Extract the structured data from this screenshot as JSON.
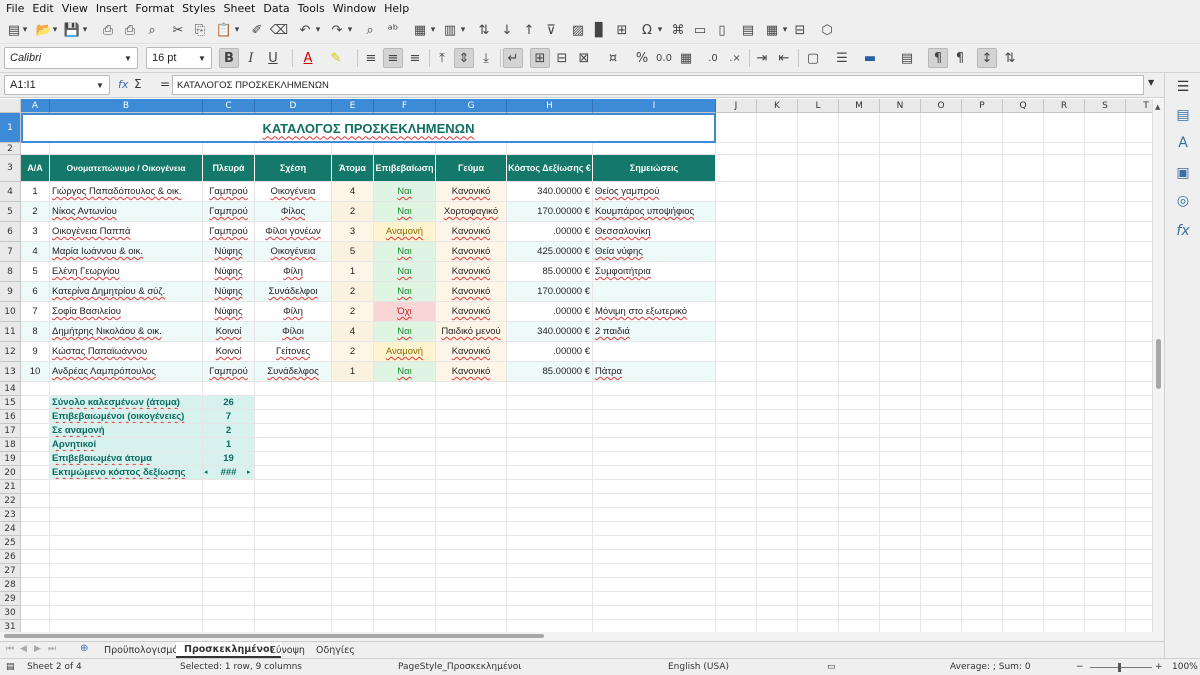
{
  "menu": [
    "File",
    "Edit",
    "View",
    "Insert",
    "Format",
    "Styles",
    "Sheet",
    "Data",
    "Tools",
    "Window",
    "Help"
  ],
  "toolbar": {
    "font_name": "Calibri",
    "font_size": "16 pt",
    "bold": "B",
    "italic": "I",
    "underline": "U",
    "percent": "%",
    "decimals": "0.0"
  },
  "formula_bar": {
    "name_box": "A1:I1",
    "fx": "fx",
    "sigma": "Σ",
    "equals": "=",
    "content": "ΚΑΤΑΛΟΓΟΣ ΠΡΟΣΚΕΚΛΗΜΕΝΩΝ"
  },
  "columns": [
    "A",
    "B",
    "C",
    "D",
    "E",
    "F",
    "G",
    "H",
    "I",
    "J",
    "K",
    "L",
    "M",
    "N",
    "O",
    "P",
    "Q",
    "R",
    "S",
    "T"
  ],
  "rows": [
    "1",
    "2",
    "3",
    "4",
    "5",
    "6",
    "7",
    "8",
    "9",
    "10",
    "11",
    "12",
    "13",
    "14",
    "15",
    "16",
    "17",
    "18",
    "19",
    "20",
    "21",
    "22",
    "23",
    "24",
    "25",
    "26",
    "27",
    "28",
    "29",
    "30",
    "31"
  ],
  "sheet": {
    "title": "ΚΑΤΑΛΟΓΟΣ ΠΡΟΣΚΕΚΛΗΜΕΝΩΝ",
    "headers": [
      "Α/Α",
      "Ονοματεπώνυμο / Οικογένεια",
      "Πλευρά",
      "Σχέση",
      "Άτομα",
      "Επιβεβαίωση",
      "Γεύμα",
      "Κόστος Δεξίωσης €",
      "Σημειώσεις"
    ],
    "guests": [
      [
        "1",
        "Γιώργος Παπαδόπουλος & οικ.",
        "Γαμπρού",
        "Οικογένεια",
        "4",
        "Ναι",
        "Κανονικό",
        "340.00000 €",
        "Θείος γαμπρού"
      ],
      [
        "2",
        "Νίκος Αντωνίου",
        "Γαμπρού",
        "Φίλος",
        "2",
        "Ναι",
        "Χορτοφαγικό",
        "170.00000 €",
        "Κουμπάρος υποψήφιος"
      ],
      [
        "3",
        "Οικογένεια Παππά",
        "Γαμπρού",
        "Φίλοι γονέων",
        "3",
        "Αναμονή",
        "Κανονικό",
        ".00000 €",
        "Θεσσαλονίκη"
      ],
      [
        "4",
        "Μαρία Ιωάννου & οικ.",
        "Νύφης",
        "Οικογένεια",
        "5",
        "Ναι",
        "Κανονικό",
        "425.00000 €",
        "Θεία νύφης"
      ],
      [
        "5",
        "Ελένη Γεωργίου",
        "Νύφης",
        "Φίλη",
        "1",
        "Ναι",
        "Κανονικό",
        "85.00000 €",
        "Συμφοιτήτρια"
      ],
      [
        "6",
        "Κατερίνα Δημητρίου & σύζ.",
        "Νύφης",
        "Συνάδελφοι",
        "2",
        "Ναι",
        "Κανονικό",
        "170.00000 €",
        ""
      ],
      [
        "7",
        "Σοφία Βασιλείου",
        "Νύφης",
        "Φίλη",
        "2",
        "Όχι",
        "Κανονικό",
        ".00000 €",
        "Μόνιμη στο εξωτερικό"
      ],
      [
        "8",
        "Δημήτρης Νικολάου & οικ.",
        "Κοινοί",
        "Φίλοι",
        "4",
        "Ναι",
        "Παιδικό μενού",
        "340.00000 €",
        "2 παιδιά"
      ],
      [
        "9",
        "Κώστας Παπαϊωάννου",
        "Κοινοί",
        "Γείτονες",
        "2",
        "Αναμονή",
        "Κανονικό",
        ".00000 €",
        ""
      ],
      [
        "10",
        "Ανδρέας Λαμπρόπουλος",
        "Γαμπρού",
        "Συνάδελφος",
        "1",
        "Ναι",
        "Κανονικό",
        "85.00000 €",
        "Πάτρα"
      ]
    ],
    "summary": [
      [
        "Σύνολο καλεσμένων (άτομα)",
        "26"
      ],
      [
        "Επιβεβαιωμένοι (οικογένειες)",
        "7"
      ],
      [
        "Σε αναμονή",
        "2"
      ],
      [
        "Αρνητικοί",
        "1"
      ],
      [
        "Επιβεβαιωμένα άτομα",
        "19"
      ],
      [
        "Εκτιμώμενο κόστος δεξίωσης",
        "###"
      ]
    ]
  },
  "sheet_tabs": [
    "Προϋπολογισμός",
    "Προσκεκλημένοι",
    "Σύνοψη",
    "Οδηγίες"
  ],
  "status": {
    "sheet": "Sheet 2 of 4",
    "selection": "Selected: 1 row, 9 columns",
    "page_style": "PageStyle_Προσκεκλημένοι",
    "language": "English (USA)",
    "summary": "Average: ; Sum: 0",
    "zoom": "100%"
  },
  "colors": {
    "header_bg": "#14786a",
    "title_text": "#0f6f63",
    "yes_bg": "#dff4e2",
    "yes_text": "#1f8a35",
    "wait_bg": "#fff4d0",
    "wait_text": "#8a6a00",
    "no_bg": "#f9d6d6",
    "no_text": "#b42222",
    "meal_bg": "#fdf6e8",
    "row_alt": "#eefaf8",
    "selection": "#3d8ad6"
  }
}
